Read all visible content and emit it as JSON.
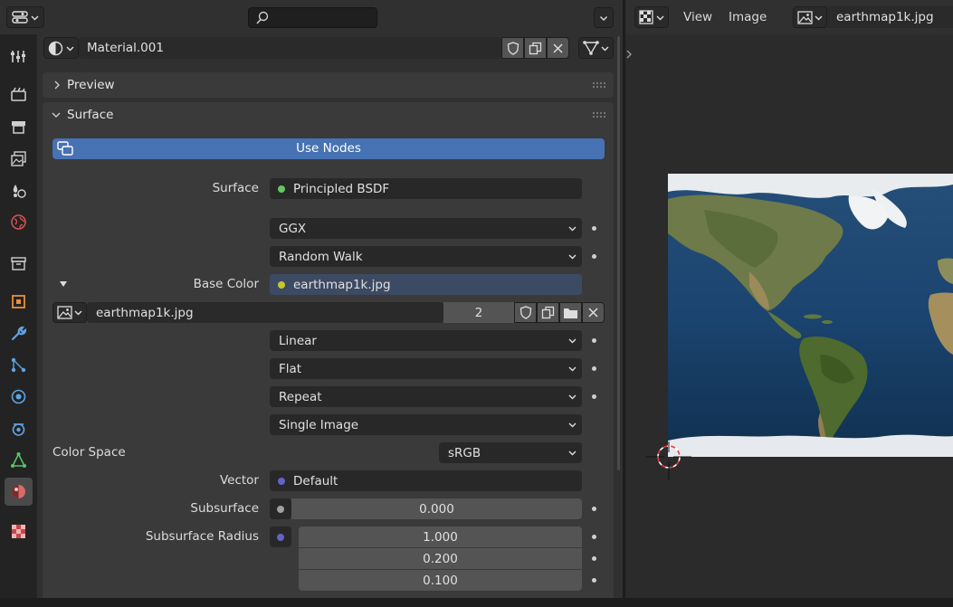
{
  "header": {
    "editor_type_icon": "properties-editor-icon",
    "search_placeholder": "",
    "material_name": "Material.001",
    "material_icon": "material-sphere-icon"
  },
  "tabs": [
    {
      "name": "tool",
      "icon": "tool-icon"
    },
    {
      "name": "render",
      "icon": "render-icon"
    },
    {
      "name": "output",
      "icon": "output-icon"
    },
    {
      "name": "view-layer",
      "icon": "view-layer-icon"
    },
    {
      "name": "scene",
      "icon": "scene-icon"
    },
    {
      "name": "world",
      "icon": "world-icon"
    },
    {
      "name": "collection",
      "icon": "collection-icon"
    },
    {
      "name": "object",
      "icon": "object-icon"
    },
    {
      "name": "modifiers",
      "icon": "wrench-icon"
    },
    {
      "name": "particles",
      "icon": "particles-icon"
    },
    {
      "name": "physics",
      "icon": "physics-icon"
    },
    {
      "name": "constraints",
      "icon": "constraints-icon"
    },
    {
      "name": "data",
      "icon": "mesh-data-icon"
    },
    {
      "name": "material",
      "icon": "material-icon",
      "active": true
    },
    {
      "name": "texture",
      "icon": "texture-icon"
    }
  ],
  "panels": {
    "preview_label": "Preview",
    "surface_label": "Surface",
    "use_nodes_label": "Use Nodes"
  },
  "surface": {
    "surface_label": "Surface",
    "surface_value": "Principled BSDF",
    "distribution": "GGX",
    "subsurface_method": "Random Walk",
    "base_color_label": "Base Color",
    "base_color_value": "earthmap1k.jpg",
    "image_name": "earthmap1k.jpg",
    "image_users": "2",
    "interpolation": "Linear",
    "projection": "Flat",
    "extension": "Repeat",
    "source": "Single Image",
    "color_space_label": "Color Space",
    "color_space_value": "sRGB",
    "vector_label": "Vector",
    "vector_value": "Default",
    "subsurface_label": "Subsurface",
    "subsurface_value": "0.000",
    "subsurface_radius_label": "Subsurface Radius",
    "subsurface_radius": [
      "1.000",
      "0.200",
      "0.100"
    ]
  },
  "image_editor": {
    "view_menu": "View",
    "image_menu": "Image",
    "image_name": "earthmap1k.jpg"
  },
  "colors": {
    "use_nodes_blue": "#4772b3",
    "socket_green": "#63c763",
    "socket_yellow": "#c7c729",
    "socket_purple": "#6363c7",
    "socket_grey": "#a1a1a1"
  }
}
